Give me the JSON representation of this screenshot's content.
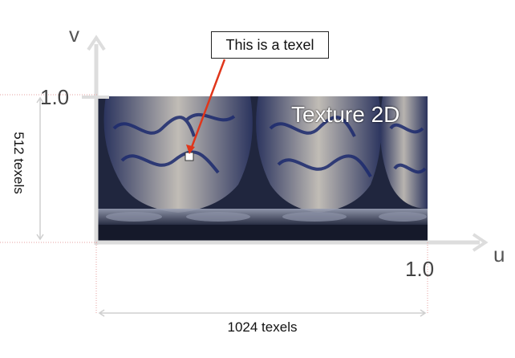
{
  "diagram": {
    "axis_v_label": "v",
    "axis_u_label": "u",
    "v_max_label": "1.0",
    "u_max_label": "1.0",
    "texture_title": "Texture 2D",
    "texel_callout": "This is a texel",
    "height_label": "512 texels",
    "width_label": "1024 texels"
  },
  "colors": {
    "axis": "#dddddd",
    "arrow": "#e0361b",
    "texel_marker": "#ffffff",
    "dotted_guides": "#e6a0a0",
    "dimension_lines": "#cfcfcf"
  }
}
